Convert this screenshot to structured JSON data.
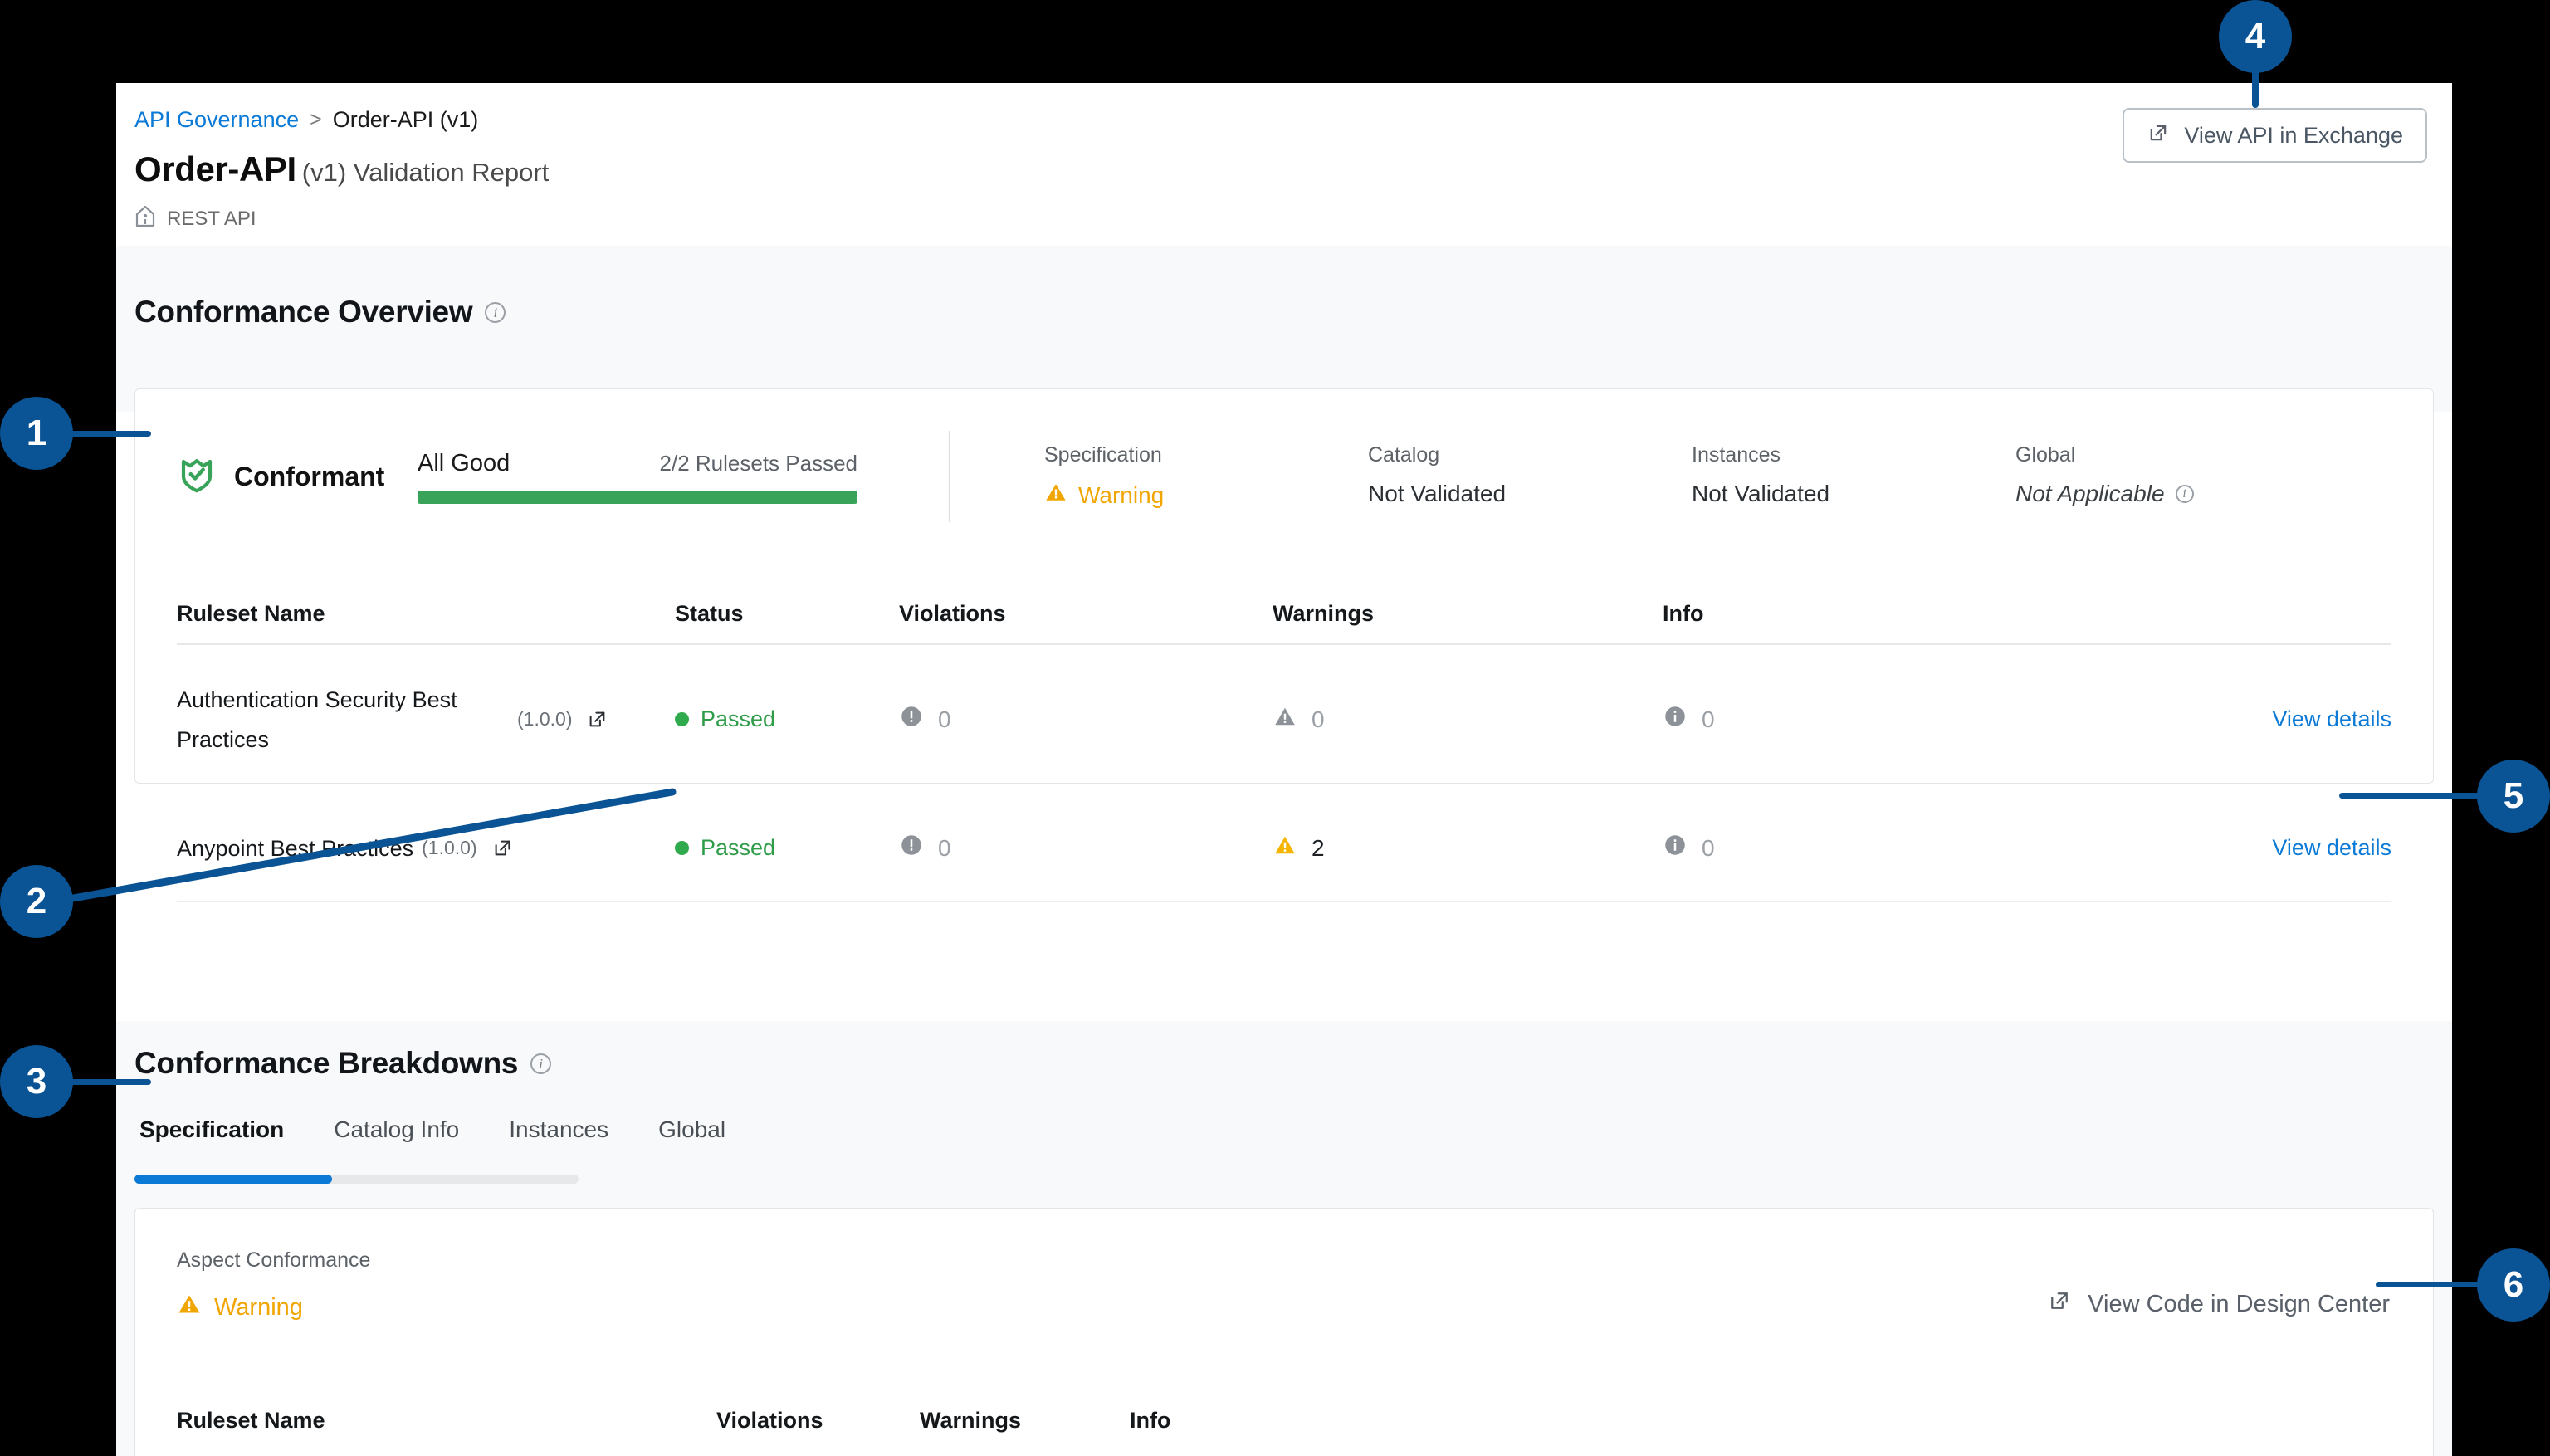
{
  "breadcrumb": {
    "root": "API Governance",
    "separator": ">",
    "current": "Order-API (v1)"
  },
  "header": {
    "title_strong": "Order-API",
    "title_light": "(v1) Validation Report",
    "api_type": "REST API",
    "api_type_icon": "api-home-icon",
    "exchange_button": {
      "label": "View API in Exchange",
      "icon": "external-link-icon"
    }
  },
  "overview": {
    "heading": "Conformance Overview",
    "heading_info_icon": "info-icon",
    "conformance": {
      "icon": "shield-check-icon",
      "label": "Conformant",
      "progress_label": "All Good",
      "progress_count": "2/2 Rulesets Passed",
      "progress_percent": 100,
      "progress_color": "#3aa35a"
    },
    "statuses": [
      {
        "label": "Specification",
        "value": "Warning",
        "state": "warning",
        "icon": "warning-triangle-icon"
      },
      {
        "label": "Catalog",
        "value": "Not Validated",
        "state": "neutral",
        "icon": ""
      },
      {
        "label": "Instances",
        "value": "Not Validated",
        "state": "neutral",
        "icon": ""
      },
      {
        "label": "Global",
        "value": "Not Applicable",
        "state": "not-applicable",
        "icon": "info-icon"
      }
    ],
    "table": {
      "columns": [
        "Ruleset Name",
        "Status",
        "Violations",
        "Warnings",
        "Info"
      ],
      "rows": [
        {
          "name": "Authentication Security Best Practices",
          "version": "(1.0.0)",
          "link_icon": "external-link-icon",
          "status": "Passed",
          "violations": "0",
          "warnings": "0",
          "info": "0",
          "violations_active": false,
          "warnings_active": false,
          "info_active": false,
          "action": "View details"
        },
        {
          "name": "Anypoint Best Practices",
          "version": "(1.0.0)",
          "link_icon": "external-link-icon",
          "status": "Passed",
          "violations": "0",
          "warnings": "2",
          "info": "0",
          "violations_active": false,
          "warnings_active": true,
          "info_active": false,
          "action": "View details"
        }
      ]
    }
  },
  "breakdowns": {
    "heading": "Conformance Breakdowns",
    "heading_info_icon": "info-icon",
    "tabs": [
      {
        "label": "Specification",
        "active": true
      },
      {
        "label": "Catalog Info",
        "active": false
      },
      {
        "label": "Instances",
        "active": false
      },
      {
        "label": "Global",
        "active": false
      }
    ],
    "aspect_label": "Aspect Conformance",
    "aspect_status": "Warning",
    "aspect_status_icon": "warning-triangle-icon",
    "design_center_link": {
      "label": "View Code in Design Center",
      "icon": "external-link-icon"
    },
    "table_columns": [
      "Ruleset Name",
      "Violations",
      "Warnings",
      "Info"
    ]
  },
  "callouts": [
    {
      "number": "1"
    },
    {
      "number": "2"
    },
    {
      "number": "3"
    },
    {
      "number": "4"
    },
    {
      "number": "5"
    },
    {
      "number": "6"
    }
  ],
  "colors": {
    "callout_blue": "#0a5394",
    "link_blue": "#0b7ad6",
    "pass_green": "#2e9c49",
    "warning_amber": "#f0a500",
    "panel_bg": "#f8f9fa"
  }
}
